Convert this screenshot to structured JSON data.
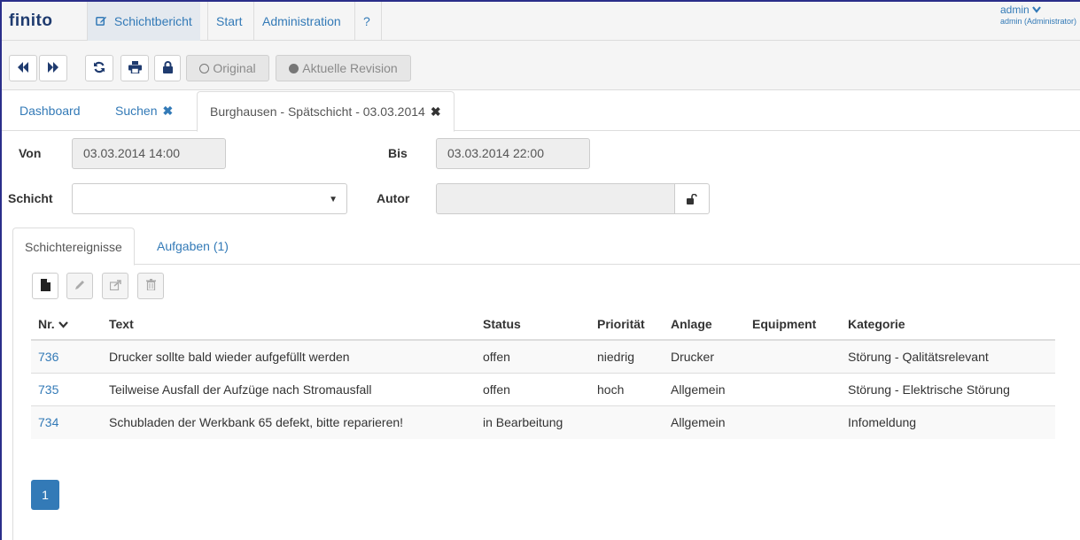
{
  "navbar": {
    "brand": "finito",
    "items": [
      {
        "label": "Schichtbericht",
        "active": true
      },
      {
        "label": "Start"
      },
      {
        "label": "Administration"
      },
      {
        "label": "?"
      }
    ],
    "user": {
      "name": "admin",
      "role": "admin (Administrator)"
    }
  },
  "toolbar": {
    "icons": [
      "fast-backward-icon",
      "fast-forward-icon",
      "refresh-icon",
      "print-icon",
      "lock-icon"
    ],
    "original_label": "Original",
    "revision_label": "Aktuelle Revision"
  },
  "page_tabs": [
    {
      "label": "Dashboard"
    },
    {
      "label": "Suchen",
      "closable": true
    },
    {
      "label": "Burghausen - Spätschicht - 03.03.2014",
      "closable": true,
      "active": true
    }
  ],
  "form": {
    "von_label": "Von",
    "von_value": "03.03.2014 14:00",
    "bis_label": "Bis",
    "bis_value": "03.03.2014 22:00",
    "schicht_label": "Schicht",
    "schicht_value": "",
    "autor_label": "Autor",
    "autor_value": ""
  },
  "inner_tabs": [
    {
      "label": "Schichtereignisse",
      "active": true
    },
    {
      "label": "Aufgaben (1)"
    }
  ],
  "table": {
    "columns": [
      "Nr.",
      "Text",
      "Status",
      "Priorität",
      "Anlage",
      "Equipment",
      "Kategorie"
    ],
    "rows": [
      {
        "nr": "736",
        "text": "Drucker sollte bald wieder aufgefüllt werden",
        "status": "offen",
        "prioritaet": "niedrig",
        "anlage": "Drucker",
        "equipment": "",
        "kategorie": "Störung - Qalitätsrelevant"
      },
      {
        "nr": "735",
        "text": "Teilweise Ausfall der Aufzüge nach Stromausfall",
        "status": "offen",
        "prioritaet": "hoch",
        "anlage": "Allgemein",
        "equipment": "",
        "kategorie": "Störung - Elektrische Störung"
      },
      {
        "nr": "734",
        "text": "Schubladen der Werkbank 65 defekt, bitte reparieren!",
        "status": "in Bearbeitung",
        "prioritaet": "",
        "anlage": "Allgemein",
        "equipment": "",
        "kategorie": "Infomeldung"
      }
    ]
  },
  "pagination": {
    "current": "1"
  },
  "colors": {
    "accent": "#337ab7",
    "brand": "#1f3b6f",
    "navbar_bg": "#f5f5f5"
  }
}
